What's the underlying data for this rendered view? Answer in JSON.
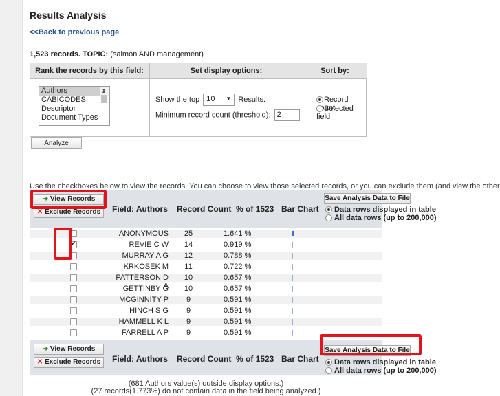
{
  "page": {
    "title": "Results Analysis",
    "back_link": "<<Back to previous page",
    "record_count": "1,523 records.",
    "topic_label": "TOPIC:",
    "topic_value": "(salmon AND management)"
  },
  "options": {
    "rank_header": "Rank the records by this field:",
    "display_header": "Set display options:",
    "sort_header": "Sort by:",
    "fields": [
      "Authors",
      "CABICODES",
      "Descriptor",
      "Document Types"
    ],
    "show_top_prefix": "Show the top",
    "show_top_value": "10",
    "show_top_suffix": "Results.",
    "min_count_label": "Minimum record count (threshold):",
    "min_count_value": "2",
    "sort_record_count": "Record count",
    "sort_selected_field": "Selected field",
    "analyze_label": "Analyze"
  },
  "instructions": "Use the checkboxes below to view the records. You can choose to view those selected records, or you can exclude them (and view the others).",
  "table": {
    "view_records": "View Records",
    "exclude_records": "Exclude Records",
    "col_field": "Field: Authors",
    "col_count": "Record Count",
    "col_pct": "% of 1523",
    "col_bar": "Bar Chart",
    "save_label": "Save Analysis Data to File",
    "radio_displayed": "Data rows displayed in table",
    "radio_all": "All data rows (up to 200,000)",
    "rows": [
      {
        "name": "ANONYMOUS",
        "count": "25",
        "pct": "1.641 %",
        "checked": false
      },
      {
        "name": "REVIE C W",
        "count": "14",
        "pct": "0.919 %",
        "checked": true
      },
      {
        "name": "MURRAY A G",
        "count": "12",
        "pct": "0.788 %",
        "checked": false
      },
      {
        "name": "KRKOSEK M",
        "count": "11",
        "pct": "0.722 %",
        "checked": false
      },
      {
        "name": "PATTERSON D A",
        "count": "10",
        "pct": "0.657 %",
        "checked": false
      },
      {
        "name": "GETTINBY G",
        "count": "10",
        "pct": "0.657 %",
        "checked": false
      },
      {
        "name": "MCGINNITY P",
        "count": "9",
        "pct": "0.591 %",
        "checked": false
      },
      {
        "name": "HINCH S G",
        "count": "9",
        "pct": "0.591 %",
        "checked": false
      },
      {
        "name": "HAMMELL K L",
        "count": "9",
        "pct": "0.591 %",
        "checked": false
      },
      {
        "name": "FARRELL A P",
        "count": "9",
        "pct": "0.591 %",
        "checked": false
      }
    ]
  },
  "footer": {
    "line1": "(681 Authors value(s) outside display options.)",
    "line2": "(27 records(1.773%) do not contain data in the field being analyzed.)"
  },
  "colors": {
    "highlight": "#e2141b",
    "link": "#1f4f8f",
    "header_bg": "#dfe3e8"
  }
}
